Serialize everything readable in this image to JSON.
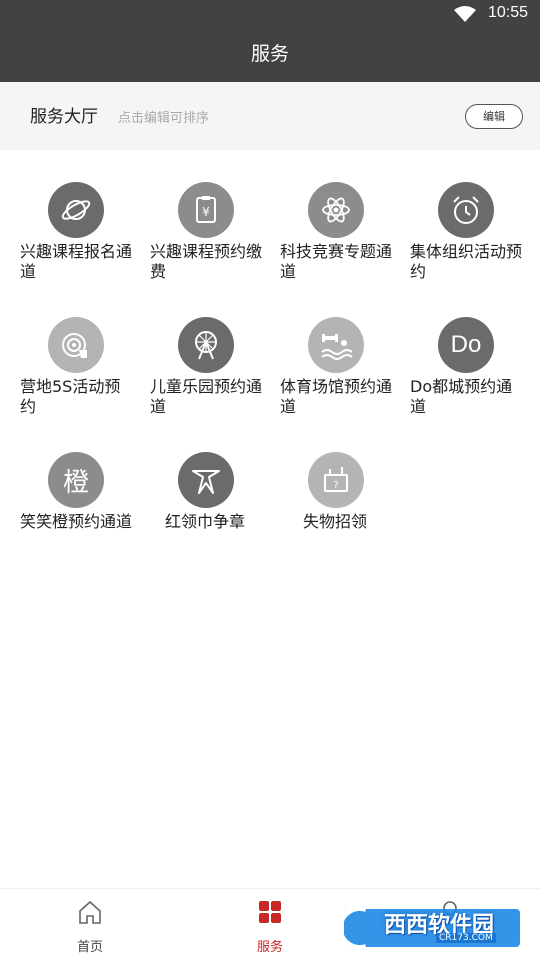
{
  "status_bar": {
    "time": "10:55"
  },
  "title": "服务",
  "section": {
    "title": "服务大厅",
    "hint": "点击编辑可排序",
    "edit_label": "编辑"
  },
  "services": [
    {
      "label": "兴趣课程报名通道",
      "icon": "planet-icon",
      "tone": "dark"
    },
    {
      "label": "兴趣课程预约缴费",
      "icon": "receipt-yen-icon",
      "tone": "mid"
    },
    {
      "label": "科技竞赛专题通道",
      "icon": "atom-icon",
      "tone": "mid"
    },
    {
      "label": "集体组织活动预约",
      "icon": "alarm-clock-icon",
      "tone": "dark"
    },
    {
      "label": "营地5S活动预约",
      "icon": "target-hand-icon",
      "tone": "light"
    },
    {
      "label": "儿童乐园预约通道",
      "icon": "ferris-wheel-icon",
      "tone": "dark"
    },
    {
      "label": "体育场馆预约通道",
      "icon": "sports-swim-icon",
      "tone": "light"
    },
    {
      "label": "Do都城预约通道",
      "icon": "do-icon",
      "tone": "dark",
      "glyph": "Do"
    },
    {
      "label": "笑笑橙预约通道",
      "icon": "cheng-icon",
      "tone": "mid",
      "glyph": "橙"
    },
    {
      "label": "红领巾争章",
      "icon": "scarf-icon",
      "tone": "dark"
    },
    {
      "label": "失物招领",
      "icon": "lost-box-icon",
      "tone": "light"
    }
  ],
  "tabs": [
    {
      "label": "首页",
      "icon": "home-icon",
      "active": false
    },
    {
      "label": "服务",
      "icon": "grid-icon",
      "active": true
    },
    {
      "label": "",
      "icon": "person-icon",
      "active": false
    }
  ],
  "watermark": {
    "main": "西西软件园",
    "sub": "CR173.COM"
  },
  "colors": {
    "header": "#424242",
    "accent": "#c62828",
    "section_bg": "#f5f5f5"
  }
}
